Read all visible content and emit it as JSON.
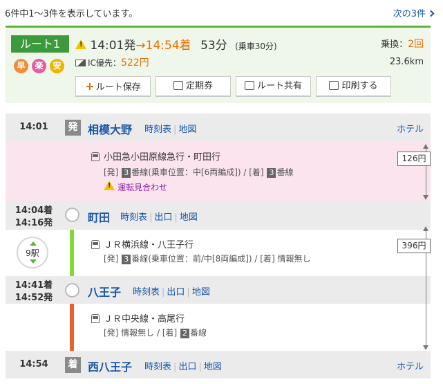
{
  "header": {
    "result_count": "6件中1〜3件を表示しています。",
    "next_page": "次の3件"
  },
  "summary": {
    "route_label": "ルート1",
    "merit_icons": [
      {
        "label": "早",
        "color": "#f08c3c"
      },
      {
        "label": "楽",
        "color": "#e85aa0"
      },
      {
        "label": "安",
        "color": "#f0b400"
      }
    ],
    "depart": "14:01発",
    "arrow": "→",
    "arrive": "14:54着",
    "duration": "53分",
    "ride_time": "(乗車30分)",
    "fare_prefix": "IC優先：",
    "fare": "522円",
    "transfer_label": "乗換：",
    "transfer_count": "2回",
    "distance": "23.6km",
    "buttons": {
      "save": "ルート保存",
      "commuter": "定期券",
      "share": "ルート共有",
      "print": "印刷する"
    }
  },
  "stations": [
    {
      "time": "14:01",
      "tag": "発",
      "name": "相模大野",
      "links": [
        "時刻表",
        "地図"
      ],
      "hotel": "ホテル"
    },
    {
      "time_arr": "14:04着",
      "time_dep": "14:16発",
      "name": "町田",
      "links": [
        "時刻表",
        "出口",
        "地図"
      ]
    },
    {
      "time_arr": "14:41着",
      "time_dep": "14:52発",
      "name": "八王子",
      "links": [
        "時刻表",
        "出口",
        "地図"
      ]
    },
    {
      "time": "14:54",
      "tag": "着",
      "name": "西八王子",
      "links": [
        "時刻表",
        "出口",
        "地図"
      ],
      "hotel": "ホテル"
    }
  ],
  "legs": [
    {
      "train": "小田急小田原線急行・町田行",
      "platform_dep_prefix": "[発]",
      "platform_dep_num": "3",
      "platform_dep_suffix": "番線(乗車位置：中[6両編成]) / [着]",
      "platform_arr_num": "3",
      "platform_arr_suffix": "番線",
      "notice": "運転見合わせ",
      "color": "#6a9fd0"
    },
    {
      "train": "ＪＲ横浜線・八王子行",
      "platform_dep_prefix": "[発]",
      "platform_dep_num": "3",
      "platform_dep_suffix": "番線(乗車位置：前/中[8両編成]) / [着] 情報無し",
      "stops": "9駅",
      "color": "#7fd93a"
    },
    {
      "train": "ＪＲ中央線・高尾行",
      "platform_dep_text": "[発] 情報無し / [着]",
      "platform_arr_num": "2",
      "platform_arr_suffix": "番線",
      "color": "#e8622a"
    }
  ],
  "fares": [
    "126円",
    "396円"
  ]
}
